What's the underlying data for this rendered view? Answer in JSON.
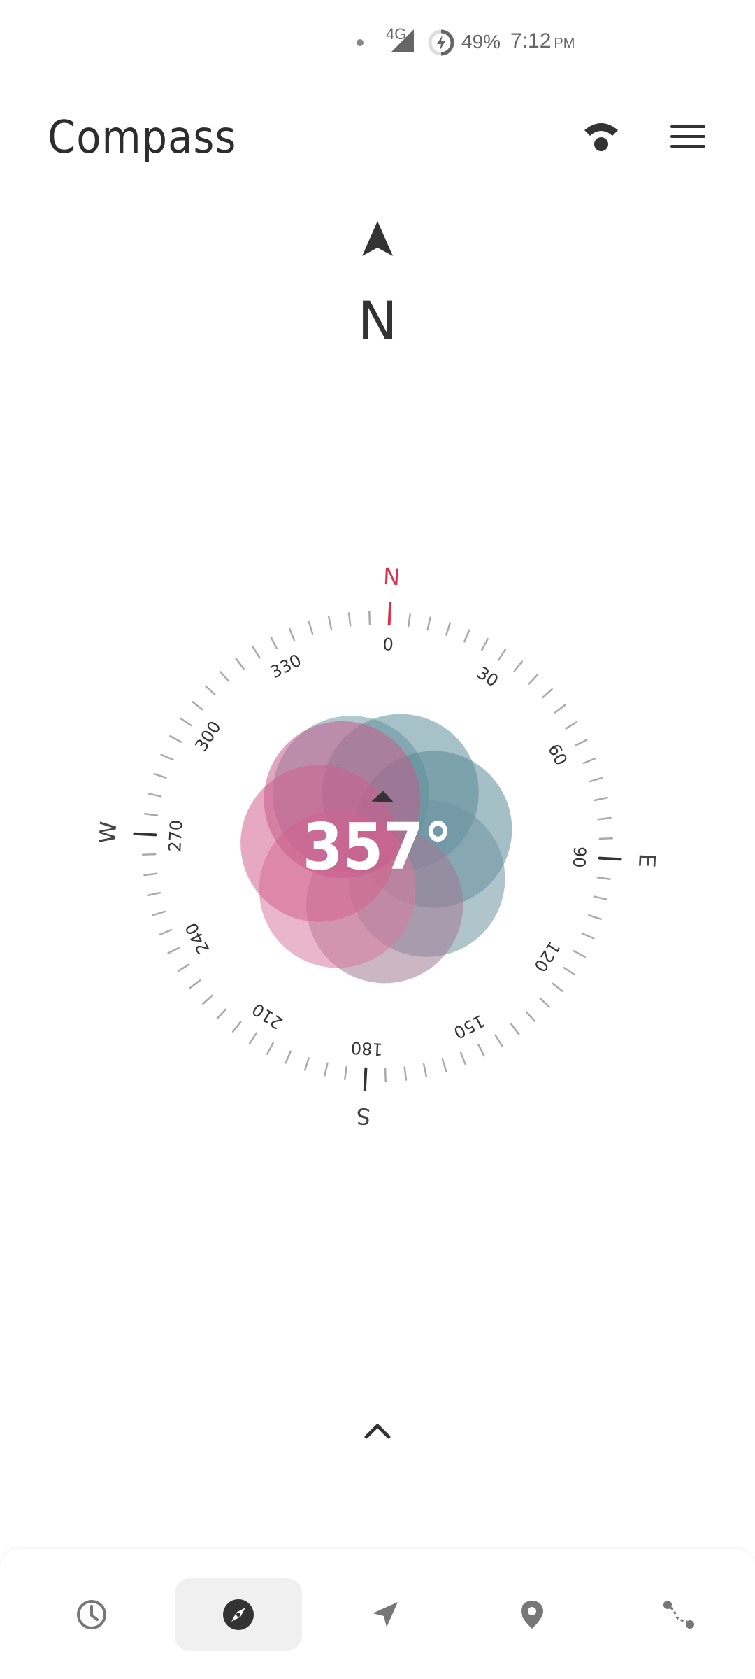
{
  "status_bar": {
    "network": "4G",
    "battery": "49%",
    "time": "7:12",
    "ampm": "PM"
  },
  "app": {
    "title": "Compass"
  },
  "heading": {
    "direction": "N",
    "degrees": "357°"
  },
  "dial": {
    "cardinals": {
      "n": "N",
      "e": "E",
      "s": "S",
      "w": "W"
    },
    "degree_labels": [
      "0",
      "30",
      "60",
      "90",
      "120",
      "150",
      "180",
      "210",
      "240",
      "270",
      "300",
      "330"
    ],
    "accent_color": "#d8344f"
  },
  "bottom_nav": [
    {
      "id": "clock",
      "icon": "clock-icon",
      "active": false
    },
    {
      "id": "compass",
      "icon": "compass-icon",
      "active": true
    },
    {
      "id": "navigate",
      "icon": "navigation-arrow-icon",
      "active": false
    },
    {
      "id": "location",
      "icon": "location-pin-icon",
      "active": false
    },
    {
      "id": "route",
      "icon": "route-icon",
      "active": false
    }
  ]
}
